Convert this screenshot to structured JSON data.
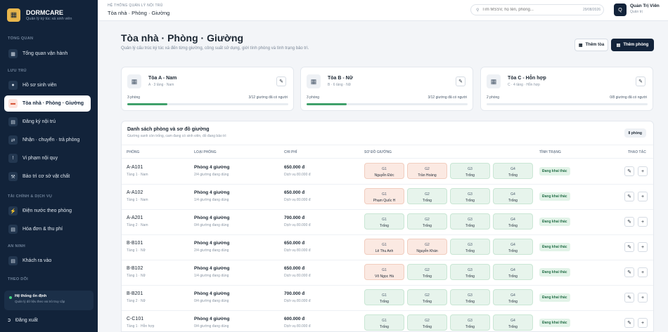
{
  "brand": {
    "name": "DORMCARE",
    "tagline": "Quản lý ký túc xá sinh viên",
    "logo_icon": "building-icon"
  },
  "sidebar": {
    "sections": [
      {
        "title": "Tổng quan",
        "items": [
          {
            "label": "Tổng quan vận hành",
            "icon": "dashboard-icon"
          }
        ]
      },
      {
        "title": "Lưu trú",
        "items": [
          {
            "label": "Hồ sơ sinh viên",
            "icon": "user-icon"
          },
          {
            "label": "Tòa nhà · Phòng · Giường",
            "icon": "bed-icon",
            "active": true
          },
          {
            "label": "Đăng ký nội trú",
            "icon": "document-icon"
          },
          {
            "label": "Nhận · chuyển · trả phòng",
            "icon": "swap-icon"
          },
          {
            "label": "Vi phạm nội quy",
            "icon": "alert-icon"
          },
          {
            "label": "Bảo trì cơ sở vật chất",
            "icon": "wrench-icon"
          }
        ]
      },
      {
        "title": "Tài chính & dịch vụ",
        "items": [
          {
            "label": "Điện nước theo phòng",
            "icon": "bolt-icon"
          },
          {
            "label": "Hóa đơn & thu phí",
            "icon": "invoice-icon"
          }
        ]
      },
      {
        "title": "An ninh",
        "items": [
          {
            "label": "Khách ra vào",
            "icon": "id-card-icon"
          }
        ]
      },
      {
        "title": "Theo dõi",
        "items": []
      }
    ],
    "status": {
      "title": "Hệ thống ổn định",
      "subtitle": "Quản lý dữ liệu theo vai trò truy cập"
    },
    "logout": "Đăng xuất"
  },
  "topbar": {
    "eyebrow": "HỆ THỐNG QUẢN LÝ NỘI TRÚ",
    "breadcrumb": "Tòa nhà · Phòng · Giường",
    "search_placeholder": "Tìm MSSV, họ tên, phòng...",
    "date": "29/08/2026",
    "user_name": "Quản Trị Viên",
    "user_role": "Quản trị",
    "avatar_initial": "Q"
  },
  "page": {
    "title": "Tòa nhà · Phòng · Giường",
    "subtitle": "Quản lý cấu trúc ký túc xá đến từng giường, công suất sử dụng, giới tính phòng và tình trạng bảo trì.",
    "add_building": "Thêm tòa",
    "add_room": "Thêm phòng"
  },
  "buildings": [
    {
      "name": "Tòa A - Nam",
      "meta": "A · 3 tầng · Nam",
      "rooms": "3 phòng",
      "occupancy": "3/12 giường đã có người",
      "ratio": 0.25
    },
    {
      "name": "Tòa B - Nữ",
      "meta": "B · 6 tầng · Nữ",
      "rooms": "3 phòng",
      "occupancy": "3/12 giường đã có người",
      "ratio": 0.25
    },
    {
      "name": "Tòa C - Hỗn hợp",
      "meta": "C · 4 tầng · Hỗn hợp",
      "rooms": "2 phòng",
      "occupancy": "0/8 giường đã có người",
      "ratio": 0
    }
  ],
  "room_table": {
    "title": "Danh sách phòng và sơ đồ giường",
    "subtitle": "Giường xanh còn trống, cam đang có sinh viên, đỏ đang bảo trì",
    "count_badge": "8 phòng",
    "headers": [
      "PHÒNG",
      "LOẠI PHÒNG",
      "CHI PHÍ",
      "SƠ ĐỒ GIƯỜNG",
      "TÌNH TRẠNG",
      "THAO TÁC"
    ],
    "rows": [
      {
        "code": "A-A101",
        "floor": "Tầng 1 · Nam",
        "type": "Phòng 4 giường",
        "usage": "2/4 giường đang dùng",
        "price": "650.000 đ",
        "service": "Dịch vụ 80.000 đ",
        "status": "Đang khai thác",
        "beds": [
          {
            "g": "G1",
            "n": "Nguyễn Đức",
            "busy": true
          },
          {
            "g": "G2",
            "n": "Trần Hoàng",
            "busy": true
          },
          {
            "g": "G3",
            "n": "Trống",
            "busy": false
          },
          {
            "g": "G4",
            "n": "Trống",
            "busy": false
          }
        ]
      },
      {
        "code": "A-A102",
        "floor": "Tầng 1 · Nam",
        "type": "Phòng 4 giường",
        "usage": "1/4 giường đang dùng",
        "price": "650.000 đ",
        "service": "Dịch vụ 80.000 đ",
        "status": "Đang khai thác",
        "beds": [
          {
            "g": "G1",
            "n": "Phạm Quốc H",
            "busy": true
          },
          {
            "g": "G2",
            "n": "Trống",
            "busy": false
          },
          {
            "g": "G3",
            "n": "Trống",
            "busy": false
          },
          {
            "g": "G4",
            "n": "Trống",
            "busy": false
          }
        ]
      },
      {
        "code": "A-A201",
        "floor": "Tầng 2 · Nam",
        "type": "Phòng 4 giường",
        "usage": "0/4 giường đang dùng",
        "price": "700.000 đ",
        "service": "Dịch vụ 80.000 đ",
        "status": "Đang khai thác",
        "beds": [
          {
            "g": "G1",
            "n": "Trống",
            "busy": false
          },
          {
            "g": "G2",
            "n": "Trống",
            "busy": false
          },
          {
            "g": "G3",
            "n": "Trống",
            "busy": false
          },
          {
            "g": "G4",
            "n": "Trống",
            "busy": false
          }
        ]
      },
      {
        "code": "B-B101",
        "floor": "Tầng 1 · Nữ",
        "type": "Phòng 4 giường",
        "usage": "2/4 giường đang dùng",
        "price": "650.000 đ",
        "service": "Dịch vụ 80.000 đ",
        "status": "Đang khai thác",
        "beds": [
          {
            "g": "G1",
            "n": "Lê Thu Anh",
            "busy": true
          },
          {
            "g": "G2",
            "n": "Nguyễn Khán",
            "busy": true
          },
          {
            "g": "G3",
            "n": "Trống",
            "busy": false
          },
          {
            "g": "G4",
            "n": "Trống",
            "busy": false
          }
        ]
      },
      {
        "code": "B-B102",
        "floor": "Tầng 1 · Nữ",
        "type": "Phòng 4 giường",
        "usage": "1/4 giường đang dùng",
        "price": "650.000 đ",
        "service": "Dịch vụ 80.000 đ",
        "status": "Đang khai thác",
        "beds": [
          {
            "g": "G1",
            "n": "Võ Ngọc Hà",
            "busy": true
          },
          {
            "g": "G2",
            "n": "Trống",
            "busy": false
          },
          {
            "g": "G3",
            "n": "Trống",
            "busy": false
          },
          {
            "g": "G4",
            "n": "Trống",
            "busy": false
          }
        ]
      },
      {
        "code": "B-B201",
        "floor": "Tầng 2 · Nữ",
        "type": "Phòng 4 giường",
        "usage": "0/4 giường đang dùng",
        "price": "700.000 đ",
        "service": "Dịch vụ 80.000 đ",
        "status": "Đang khai thác",
        "beds": [
          {
            "g": "G1",
            "n": "Trống",
            "busy": false
          },
          {
            "g": "G2",
            "n": "Trống",
            "busy": false
          },
          {
            "g": "G3",
            "n": "Trống",
            "busy": false
          },
          {
            "g": "G4",
            "n": "Trống",
            "busy": false
          }
        ]
      },
      {
        "code": "C-C101",
        "floor": "Tầng 1 · Hỗn hợp",
        "type": "Phòng 4 giường",
        "usage": "0/4 giường đang dùng",
        "price": "600.000 đ",
        "service": "Dịch vụ 80.000 đ",
        "status": "Đang khai thác",
        "beds": [
          {
            "g": "G1",
            "n": "Trống",
            "busy": false
          },
          {
            "g": "G2",
            "n": "Trống",
            "busy": false
          },
          {
            "g": "G3",
            "n": "Trống",
            "busy": false
          },
          {
            "g": "G4",
            "n": "Trống",
            "busy": false
          }
        ]
      }
    ]
  },
  "colors": {
    "sidebar": "#12233a",
    "accent": "#d85a3c",
    "free_bed": "#e7f4ec",
    "busy_bed": "#fbe9e2",
    "progress": "#3fa06a"
  }
}
